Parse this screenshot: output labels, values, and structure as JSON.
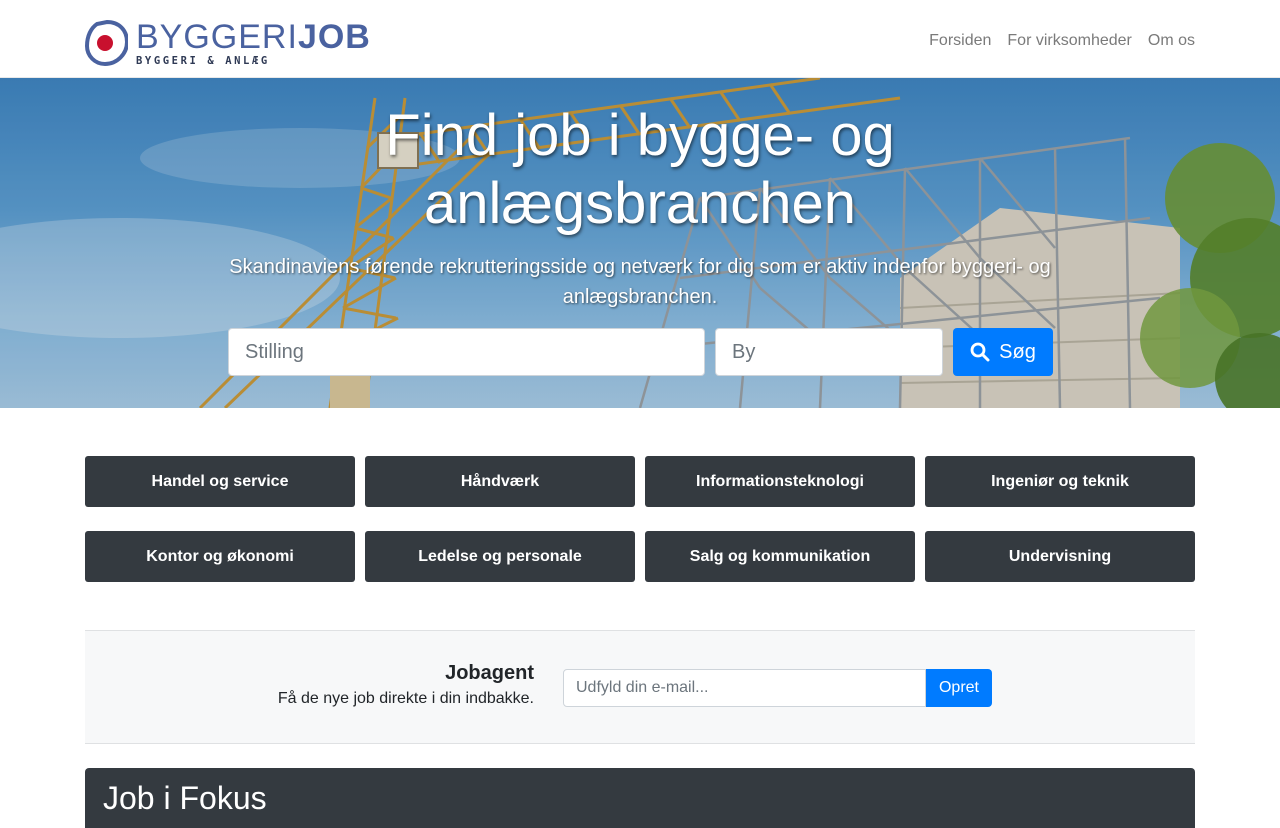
{
  "brand": {
    "name_light": "BYGGERI",
    "name_bold": "JOB",
    "tagline": "BYGGERI & ANLÆG",
    "color": "#4a62a0",
    "mark_color": "#c8102e"
  },
  "nav": {
    "items": [
      {
        "label": "Forsiden"
      },
      {
        "label": "For virksomheder"
      },
      {
        "label": "Om os"
      }
    ]
  },
  "hero": {
    "title": "Find job i bygge- og anlægsbranchen",
    "subtitle": "Skandinaviens førende rekrutteringsside og netværk for dig som er aktiv indenfor byggeri- og anlægsbranchen.",
    "search": {
      "job_placeholder": "Stilling",
      "city_placeholder": "By",
      "button_label": "Søg",
      "button_icon": "search-icon"
    }
  },
  "categories": [
    {
      "label": "Handel og service"
    },
    {
      "label": "Håndværk"
    },
    {
      "label": "Informationsteknologi"
    },
    {
      "label": "Ingeniør og teknik"
    },
    {
      "label": "Kontor og økonomi"
    },
    {
      "label": "Ledelse og personale"
    },
    {
      "label": "Salg og kommunikation"
    },
    {
      "label": "Undervisning"
    }
  ],
  "jobagent": {
    "title": "Jobagent",
    "description": "Få de nye job direkte i din indbakke.",
    "email_placeholder": "Udfyld din e-mail...",
    "button_label": "Opret"
  },
  "focus": {
    "title": "Job i Fokus"
  },
  "colors": {
    "primary": "#007bff",
    "dark": "#343a40"
  }
}
